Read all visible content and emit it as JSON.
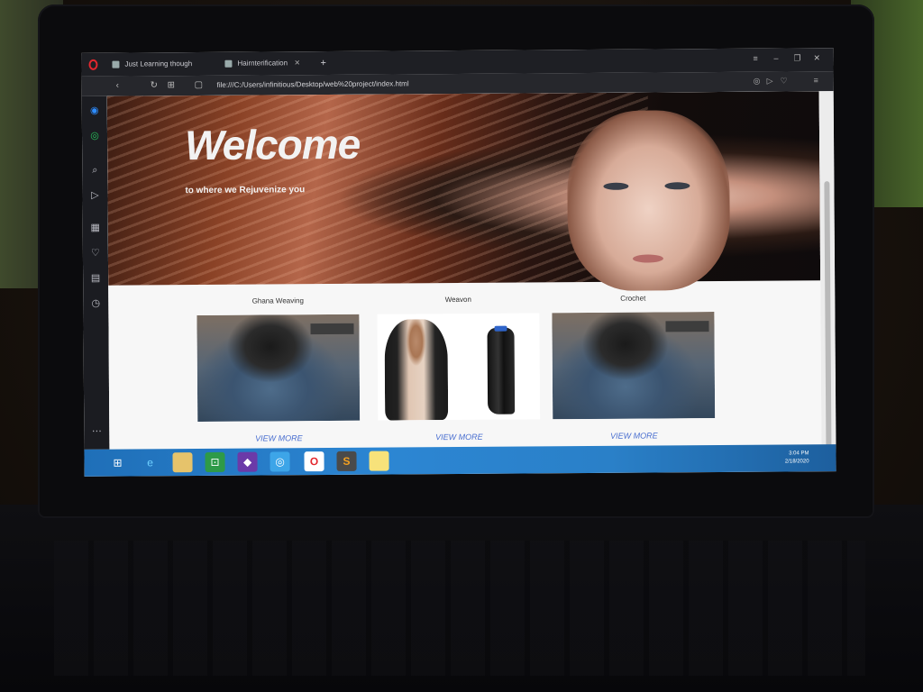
{
  "browser": {
    "tabs": [
      {
        "label": "Just Learning though"
      },
      {
        "label": "Hairnterification"
      }
    ],
    "new_tab": "+",
    "url": "file:///C:/Users/infinitious/Desktop/web%20project/index.html"
  },
  "hero": {
    "title": "Welcome",
    "subtitle": "to where we Rejuvenize you"
  },
  "cards": [
    {
      "title": "Ghana Weaving",
      "link": "VIEW MORE"
    },
    {
      "title": "Weavon",
      "link": "VIEW MORE"
    },
    {
      "title": "Crochet",
      "link": "VIEW MORE"
    }
  ],
  "taskbar": {
    "time": "3:04 PM",
    "date": "2/18/2020"
  },
  "colors": {
    "link": "#4a6fd0",
    "taskbar": "#2c86d3",
    "opera_red": "#e3272e"
  },
  "icons": {
    "sidebar": [
      "messenger-icon",
      "whatsapp-icon",
      "search-icon",
      "send-icon",
      "grid-icon",
      "heart-icon",
      "news-icon",
      "history-icon",
      "more-icon"
    ],
    "taskbar": [
      "windows-start-icon",
      "internet-explorer-icon",
      "file-explorer-icon",
      "store-icon",
      "visual-studio-icon",
      "chrome-icon",
      "opera-icon",
      "sublime-icon",
      "sticky-notes-icon"
    ]
  }
}
